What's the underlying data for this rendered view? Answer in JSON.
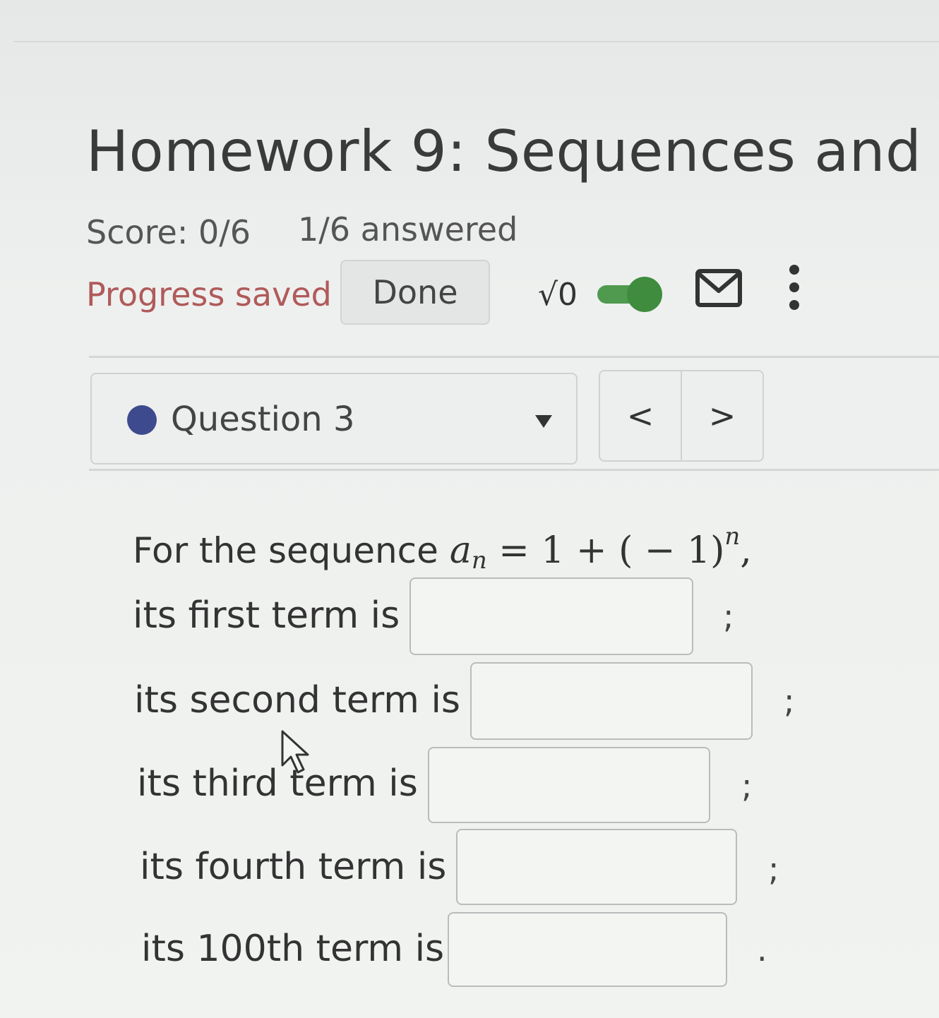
{
  "header": {
    "title": "Homework 9: Sequences and",
    "score": "Score: 0/6",
    "answered": "1/6 answered",
    "progress_status": "Progress saved",
    "done_label": "Done",
    "sqrt_label": "√0",
    "toggle_on": true,
    "accent_color": "#3f8c3f"
  },
  "question_nav": {
    "current_label": "Question 3",
    "prev_label": "<",
    "next_label": ">"
  },
  "problem": {
    "intro": "For the sequence",
    "formula": {
      "lhs": "a",
      "lhs_subscript": "n",
      "rhs": "= 1 + ( − 1)",
      "exponent": "n",
      "trailing": ","
    },
    "rows": [
      {
        "label": "its first term is",
        "value": "",
        "punct": ";"
      },
      {
        "label": "its second term is",
        "value": "",
        "punct": ";"
      },
      {
        "label": "its third term is",
        "value": "",
        "punct": ";"
      },
      {
        "label": "its fourth term is",
        "value": "",
        "punct": ";"
      },
      {
        "label": "its 100th term is",
        "value": "",
        "punct": "."
      }
    ]
  },
  "icons": [
    "mail-icon",
    "kebab-menu-icon",
    "chevron-down-icon",
    "mouse-cursor-icon"
  ]
}
